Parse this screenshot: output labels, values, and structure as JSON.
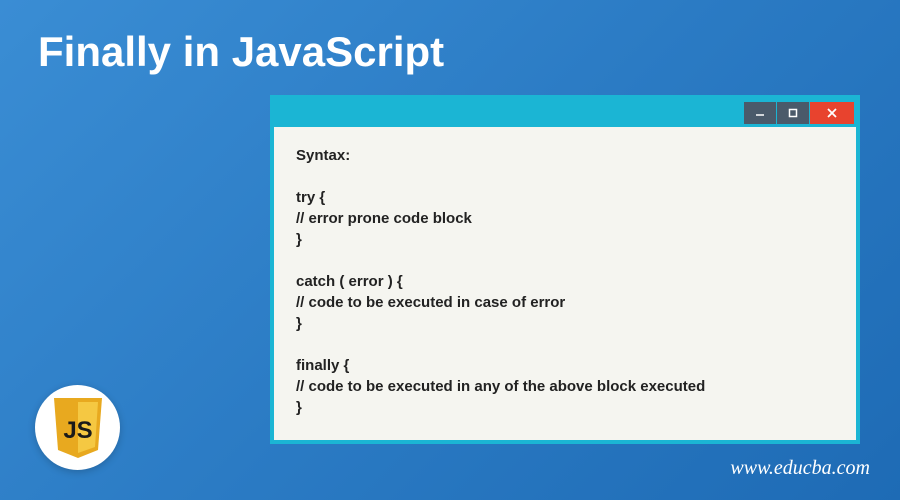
{
  "title": "Finally in JavaScript",
  "code_window": {
    "content": "Syntax:\n\ntry {\n// error prone code block\n}\n\ncatch ( error ) {\n// code to be executed in case of error\n}\n\nfinally {\n// code to be executed in any of the above block executed\n}"
  },
  "logo": {
    "label": "JS"
  },
  "footer": {
    "url": "www.educba.com"
  }
}
